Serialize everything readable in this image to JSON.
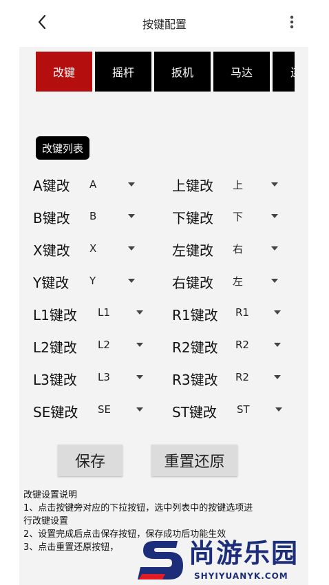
{
  "header": {
    "title": "按键配置"
  },
  "icons": {
    "back": "chevron-left-icon",
    "more": "more-vertical-icon"
  },
  "tabs": [
    {
      "label": "改键",
      "active": true
    },
    {
      "label": "摇杆",
      "active": false
    },
    {
      "label": "扳机",
      "active": false
    },
    {
      "label": "马达",
      "active": false
    },
    {
      "label": "连",
      "active": false
    }
  ],
  "remap_list_button": "改键列表",
  "mappings_left": [
    {
      "label": "A键改",
      "value": "A"
    },
    {
      "label": "B键改",
      "value": "B"
    },
    {
      "label": "X键改",
      "value": "X"
    },
    {
      "label": "Y键改",
      "value": "Y"
    },
    {
      "label": "L1键改",
      "value": "L1"
    },
    {
      "label": "L2键改",
      "value": "L2"
    },
    {
      "label": "L3键改",
      "value": "L3"
    },
    {
      "label": "SE键改",
      "value": "SE"
    }
  ],
  "mappings_right": [
    {
      "label": "上键改",
      "value": "上"
    },
    {
      "label": "下键改",
      "value": "下"
    },
    {
      "label": "左键改",
      "value": "右"
    },
    {
      "label": "右键改",
      "value": "左"
    },
    {
      "label": "R1键改",
      "value": "R1"
    },
    {
      "label": "R2键改",
      "value": "R2"
    },
    {
      "label": "R3键改",
      "value": "R2"
    },
    {
      "label": "ST键改",
      "value": "ST"
    }
  ],
  "actions": {
    "save": "保存",
    "reset": "重置还原"
  },
  "help": {
    "title": "改键设置说明",
    "lines": [
      "1、点击按键旁对应的下拉按钮，选中列表中的按键选项进",
      "行改键设置",
      "2、设置完成后点击保存按钮，保存成功后功能生效",
      "3、点击重置还原按钮，"
    ]
  },
  "watermark": {
    "name": "尚游乐园",
    "domain": "SHYIYUANYK.COM"
  },
  "colors": {
    "active_tab": "#b40e0e",
    "tab": "#000000",
    "panel": "#f3f3f3",
    "watermark": "#1c2e7a",
    "watermark_accent": "#e01b22"
  }
}
